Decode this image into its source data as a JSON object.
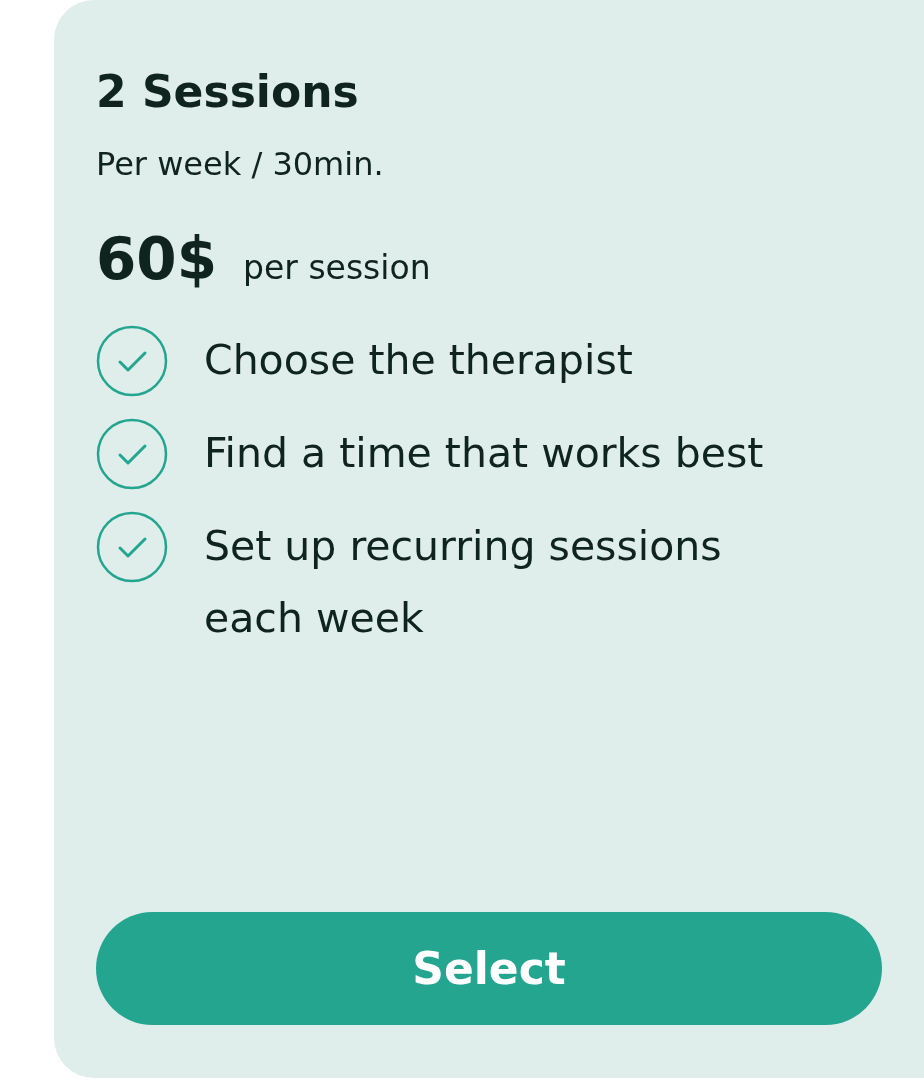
{
  "plan": {
    "title": "2 Sessions",
    "subtitle": "Per week / 30min.",
    "price": "60$",
    "price_unit": "per session",
    "features": [
      "Choose the therapist",
      "Find a time that works best",
      "Set up recurring sessions each week"
    ],
    "button": "Select"
  }
}
